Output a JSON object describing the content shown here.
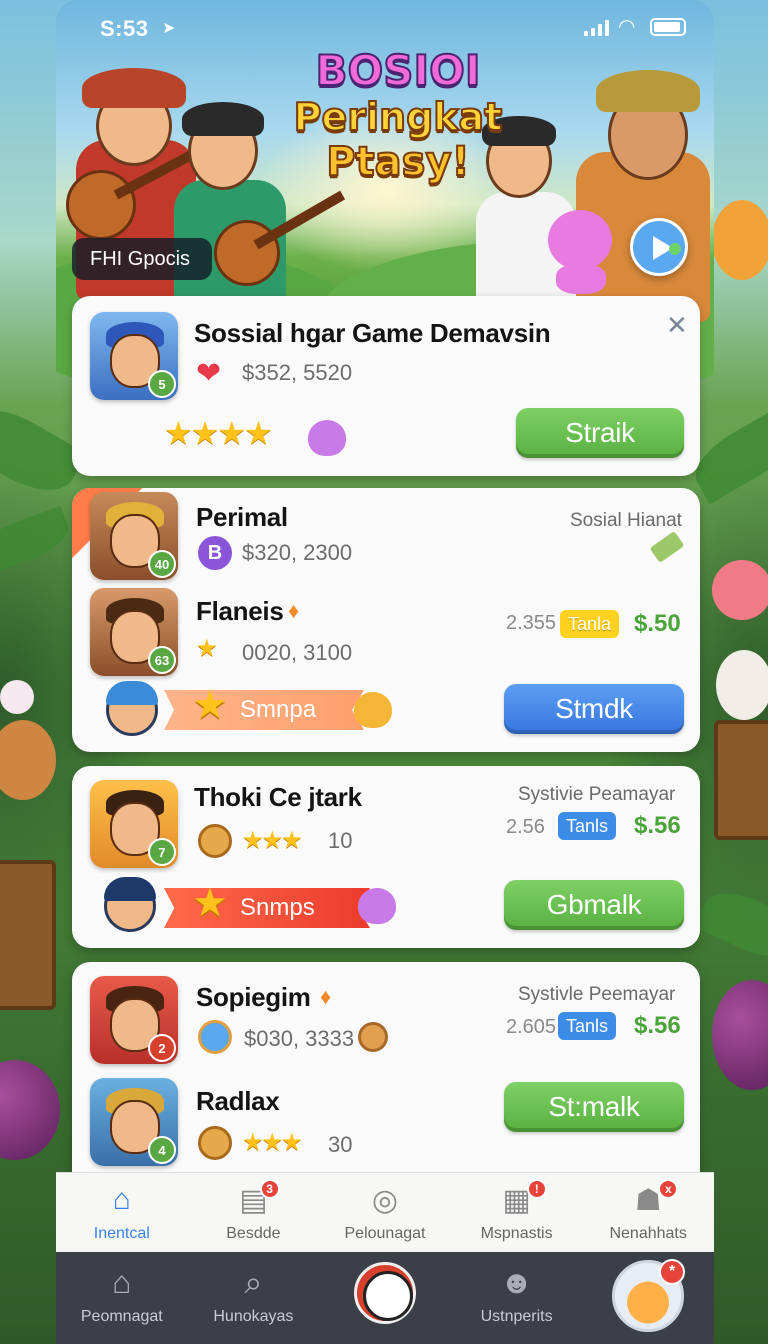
{
  "status_bar": {
    "time": "S:53"
  },
  "hero": {
    "title_line1": "BOSIOI",
    "title_line2": "Peringkat",
    "title_line3": "Ptasy!",
    "pill_label": "FHI Gpocis"
  },
  "featured": {
    "name": "Sossial hgar Game Demavsin",
    "value": "$352, 5520",
    "level": "5",
    "stars": "★★★★",
    "button": "Straik"
  },
  "list1": {
    "header_right": "Sosial Hianat",
    "p1": {
      "name": "Perimal",
      "value": "$320, 2300",
      "level": "40",
      "coin_letter": "B"
    },
    "p2": {
      "name": "Flaneis",
      "value": "0020, 3100",
      "level": "63",
      "odds": "2.355",
      "tag": "Tanla",
      "price": "$.50"
    },
    "ribbon": "Smnpa",
    "button": "Stmdk"
  },
  "list2": {
    "header_right": "Systivie Peamayar",
    "p1": {
      "name": "Thoki Ce jtark",
      "stars": "★★★",
      "count": "10",
      "level": "7",
      "odds": "2.56",
      "tag": "Tanls",
      "price": "$.56"
    },
    "ribbon": "Snmps",
    "button": "Gbmalk"
  },
  "list3": {
    "header_right": "Systivle Peemayar",
    "p1": {
      "name": "Sopiegim",
      "value": "$030, 3333",
      "level": "2",
      "odds": "2.605",
      "tag": "Tanls",
      "price": "$.56"
    },
    "p2": {
      "name": "Radlax",
      "stars": "★★★",
      "count": "30",
      "level": "4"
    },
    "button": "St:malk"
  },
  "tabbar_primary": [
    {
      "label": "Inentcal",
      "icon": "home-icon",
      "active": true
    },
    {
      "label": "Besdde",
      "icon": "document-icon",
      "badge": "3"
    },
    {
      "label": "Pelounagat",
      "icon": "globe-icon"
    },
    {
      "label": "Mspnastis",
      "icon": "grid-icon",
      "badge": "!"
    },
    {
      "label": "Nenahhats",
      "icon": "user-icon",
      "badge": "x"
    }
  ],
  "tabbar_secondary": [
    {
      "label": "Peomnagat",
      "icon": "home-icon"
    },
    {
      "label": "Hunokayas",
      "icon": "search-icon"
    },
    {
      "label": "",
      "icon": "record-button"
    },
    {
      "label": "Ustnperits",
      "icon": "face-icon"
    },
    {
      "label": "",
      "icon": "profile-avatar",
      "badge": "*"
    }
  ],
  "colors": {
    "accent_blue": "#3b82e8",
    "button_green": "#58b040",
    "price_green": "#4aa43a",
    "tag_yellow": "#ffd21f",
    "ribbon_red": "#ec3b2c"
  }
}
